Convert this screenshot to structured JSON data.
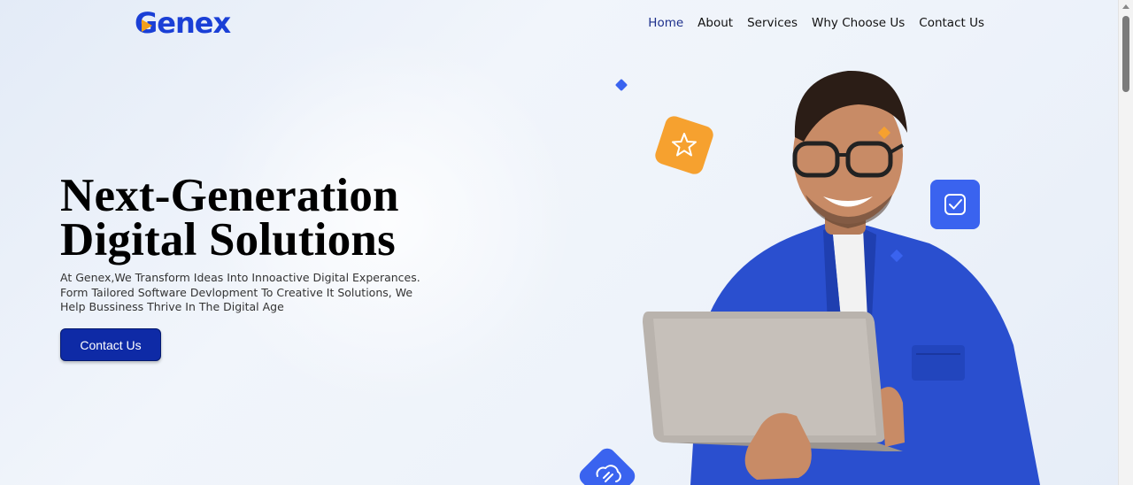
{
  "logo": {
    "first_letter": "G",
    "rest": "enex"
  },
  "nav": [
    {
      "label": "Home",
      "active": true
    },
    {
      "label": "About",
      "active": false
    },
    {
      "label": "Services",
      "active": false
    },
    {
      "label": "Why Choose Us",
      "active": false
    },
    {
      "label": "Contact Us",
      "active": false
    }
  ],
  "hero": {
    "title_line1": "Next-Generation",
    "title_line2": "Digital Solutions",
    "subtitle_line1": "At Genex,We Transform Ideas Into Innoactive Digital Experances.",
    "subtitle_line2": "Form Tailored Software Devlopment To Creative It Solutions, We",
    "subtitle_line3": "Help Bussiness Thrive In The Digital Age",
    "cta_label": "Contact Us"
  },
  "icons": [
    "star-icon",
    "checkbox-icon",
    "cloud-link-icon"
  ],
  "colors": {
    "brand_blue": "#1a3fd6",
    "accent_orange": "#f6a12f",
    "cta_blue": "#0e2aa6",
    "icon_blue": "#3a63ef"
  }
}
